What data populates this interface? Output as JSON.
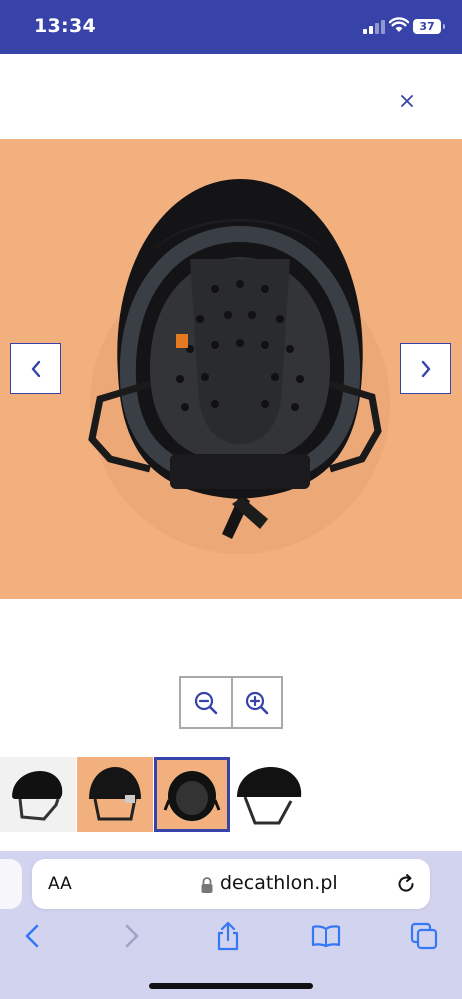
{
  "status_bar": {
    "time": "13:34",
    "battery_level": "37",
    "background_color": "#3743a8"
  },
  "modal": {
    "close_icon": "close-icon",
    "main_image": {
      "description_icon": "helmet-underside-photo",
      "background_color": "#f2b07e"
    },
    "prev_icon": "chevron-left-icon",
    "next_icon": "chevron-right-icon",
    "zoom": {
      "zoom_out_icon": "zoom-out-icon",
      "zoom_in_icon": "zoom-in-icon"
    },
    "thumbnails": [
      {
        "icon": "helmet-side-thumbnail",
        "selected": false
      },
      {
        "icon": "helmet-front-thumbnail",
        "selected": false
      },
      {
        "icon": "helmet-underside-thumbnail",
        "selected": true
      },
      {
        "icon": "helmet-angle-thumbnail",
        "selected": false
      }
    ],
    "accent_color": "#3743a8"
  },
  "safari": {
    "aa_label": "AA",
    "url": "decathlon.pl",
    "lock_icon": "lock-icon",
    "reload_icon": "reload-icon",
    "toolbar_icons": [
      "back-icon",
      "forward-icon",
      "share-icon",
      "bookmarks-icon",
      "tabs-icon"
    ],
    "background_color": "#d2d3ef"
  }
}
